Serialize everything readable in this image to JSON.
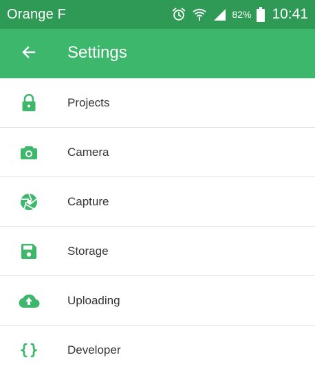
{
  "status_bar": {
    "carrier": "Orange F",
    "battery": "82%",
    "time": "10:41",
    "icons": [
      "alarm-icon",
      "wifi-icon",
      "signal-icon",
      "battery-icon"
    ]
  },
  "app_bar": {
    "title": "Settings",
    "back_icon": "arrow-back-icon"
  },
  "settings": {
    "items": [
      {
        "label": "Projects",
        "icon": "lock-icon"
      },
      {
        "label": "Camera",
        "icon": "camera-icon"
      },
      {
        "label": "Capture",
        "icon": "aperture-icon"
      },
      {
        "label": "Storage",
        "icon": "floppy-disk-icon"
      },
      {
        "label": "Uploading",
        "icon": "cloud-upload-icon"
      },
      {
        "label": "Developer",
        "icon": "code-braces-icon"
      }
    ]
  },
  "colors": {
    "status_bar": "#2f9a55",
    "app_bar": "#3db76c",
    "icon": "#3db76c",
    "divider": "#e2e2e2",
    "text": "#333333"
  }
}
